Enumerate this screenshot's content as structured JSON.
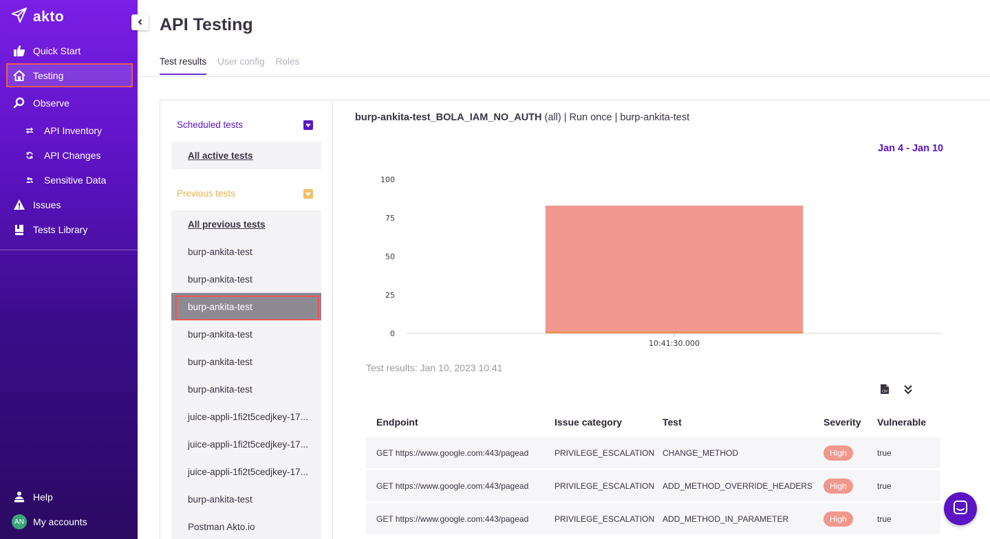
{
  "app": {
    "name": "akto"
  },
  "sidebar": {
    "items": [
      {
        "label": "Quick Start",
        "icon": "thumbs-up-icon"
      },
      {
        "label": "Testing",
        "icon": "home-icon"
      },
      {
        "label": "Observe",
        "icon": "search-icon"
      },
      {
        "label": "API Inventory",
        "icon": "swap-icon"
      },
      {
        "label": "API Changes",
        "icon": "refresh-icon"
      },
      {
        "label": "Sensitive Data",
        "icon": "users-icon"
      },
      {
        "label": "Issues",
        "icon": "warning-icon"
      },
      {
        "label": "Tests Library",
        "icon": "book-icon"
      }
    ],
    "bottom": [
      {
        "label": "Help",
        "icon": "people-icon"
      },
      {
        "label": "My accounts",
        "avatar": "AN"
      }
    ]
  },
  "page": {
    "title": "API Testing"
  },
  "tabs": [
    {
      "label": "Test results",
      "active": true
    },
    {
      "label": "User config",
      "active": false
    },
    {
      "label": "Roles",
      "active": false
    }
  ],
  "scheduled": {
    "heading": "Scheduled tests",
    "items": [
      "All active tests"
    ]
  },
  "previous": {
    "heading": "Previous tests",
    "items": [
      "All previous tests",
      "burp-ankita-test",
      "burp-ankita-test",
      "burp-ankita-test",
      "burp-ankita-test",
      "burp-ankita-test",
      "burp-ankita-test",
      "juice-appli-1fi2t5cedjkey-17...",
      "juice-appli-1fi2t5cedjkey-17...",
      "juice-appli-1fi2t5cedjkey-17...",
      "burp-ankita-test",
      "Postman Akto.io"
    ]
  },
  "test": {
    "name": "burp-ankita-test_BOLA_IAM_NO_AUTH",
    "details": " (all) | Run once | burp-ankita-test",
    "date_range": "Jan 4 - Jan 10",
    "results_heading": "Test results: Jan 10, 2023 10:41"
  },
  "chart_data": {
    "type": "bar",
    "categories": [
      "10:41:30.000"
    ],
    "series": [
      {
        "values": [
          1.5
        ],
        "color": "#e8935a"
      },
      {
        "values": [
          81.5
        ],
        "color": "#f2978f"
      }
    ],
    "stacked": true,
    "yticks": [
      0,
      25,
      50,
      75,
      100
    ],
    "ylim": [
      0,
      100
    ],
    "grid": false
  },
  "table": {
    "columns": [
      "Endpoint",
      "Issue category",
      "Test",
      "Severity",
      "Vulnerable"
    ],
    "rows": [
      [
        "GET https://www.google.com:443/pagead",
        "PRIVILEGE_ESCALATION",
        "CHANGE_METHOD",
        "High",
        "true"
      ],
      [
        "GET https://www.google.com:443/pagead",
        "PRIVILEGE_ESCALATION",
        "ADD_METHOD_OVERRIDE_HEADERS",
        "High",
        "true"
      ],
      [
        "GET https://www.google.com:443/pagead",
        "PRIVILEGE_ESCALATION",
        "ADD_METHOD_IN_PARAMETER",
        "High",
        "true"
      ]
    ]
  },
  "colors": {
    "accent": "#5a14c4",
    "highlight": "#e85a5a",
    "previous_heading": "#e8b04a",
    "severity_high": "#f0978e"
  }
}
